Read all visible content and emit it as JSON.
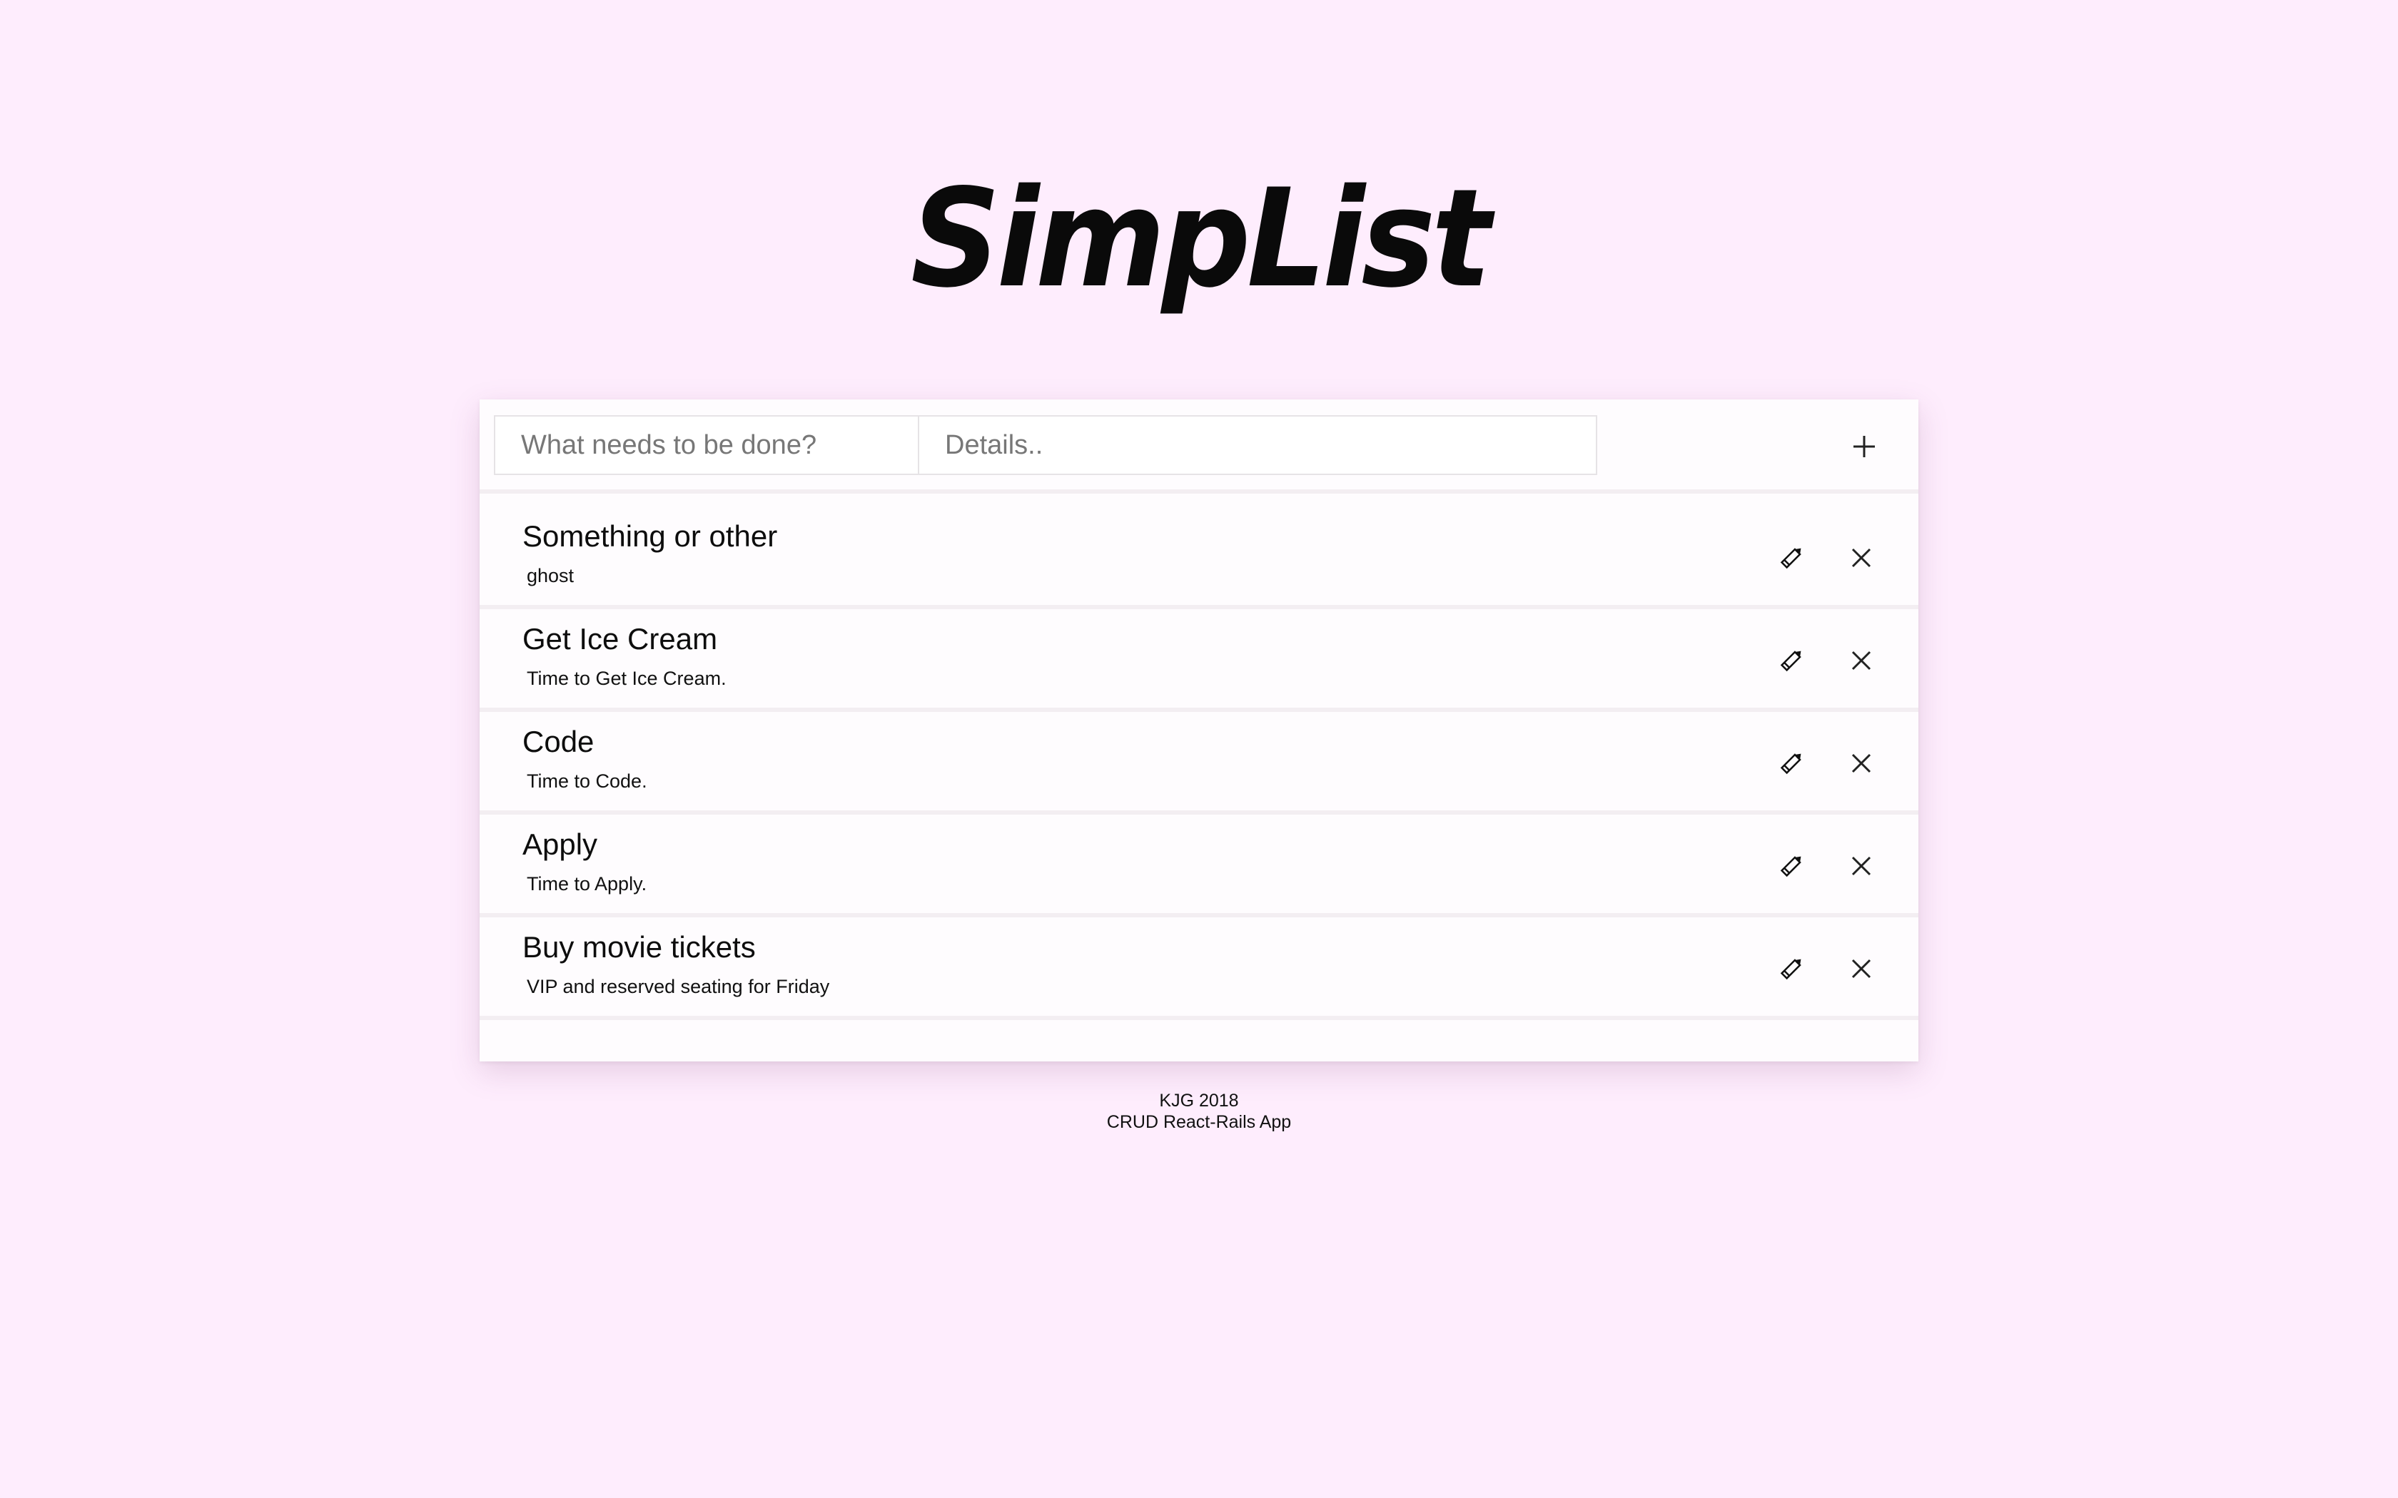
{
  "app": {
    "title": "SimpList"
  },
  "form": {
    "task_placeholder": "What needs to be done?",
    "details_placeholder": "Details..",
    "add_icon": "plus-icon"
  },
  "items": [
    {
      "title": "Something or other",
      "details": "ghost"
    },
    {
      "title": "Get Ice Cream",
      "details": "Time to Get Ice Cream."
    },
    {
      "title": "Code",
      "details": "Time to Code."
    },
    {
      "title": "Apply",
      "details": "Time to Apply."
    },
    {
      "title": "Buy movie tickets",
      "details": "VIP and reserved seating for Friday"
    }
  ],
  "item_icons": {
    "edit": "pencil-icon",
    "delete": "close-icon"
  },
  "footer": {
    "line1": "KJG 2018",
    "line2": "CRUD React-Rails App"
  },
  "colors": {
    "background": "#feedfd",
    "card": "#fefcfe",
    "divider": "#f3eef2",
    "text": "#111111"
  }
}
